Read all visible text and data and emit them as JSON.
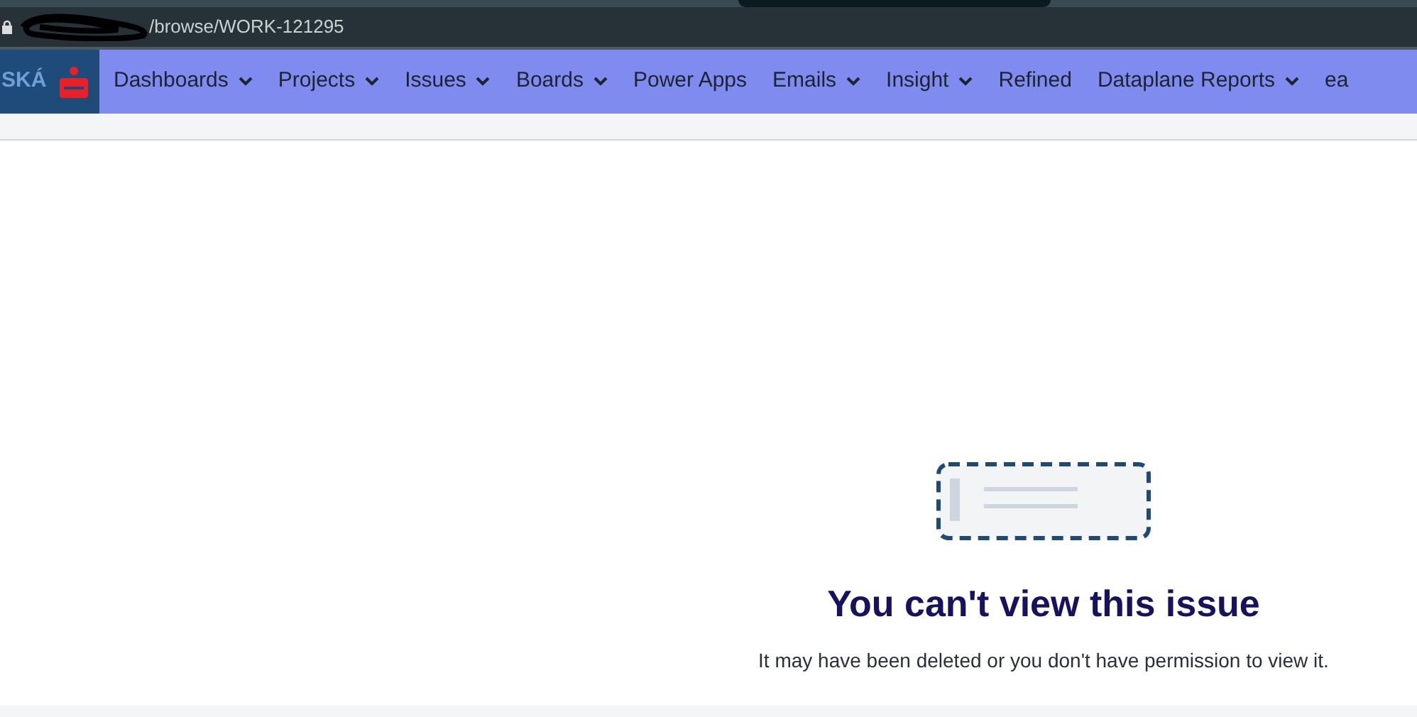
{
  "address_bar": {
    "url": "/browse/WORK-121295"
  },
  "logo": {
    "text": "SKÁ"
  },
  "nav": [
    {
      "label": "Dashboards",
      "has_menu": true
    },
    {
      "label": "Projects",
      "has_menu": true
    },
    {
      "label": "Issues",
      "has_menu": true
    },
    {
      "label": "Boards",
      "has_menu": true
    },
    {
      "label": "Power Apps",
      "has_menu": false
    },
    {
      "label": "Emails",
      "has_menu": true
    },
    {
      "label": "Insight",
      "has_menu": true
    },
    {
      "label": "Refined",
      "has_menu": false
    },
    {
      "label": "Dataplane Reports",
      "has_menu": true
    },
    {
      "label": "ea",
      "has_menu": false
    }
  ],
  "empty_state": {
    "title": "You can't view this issue",
    "message": "It may have been deleted or you don't have permission to view it."
  }
}
